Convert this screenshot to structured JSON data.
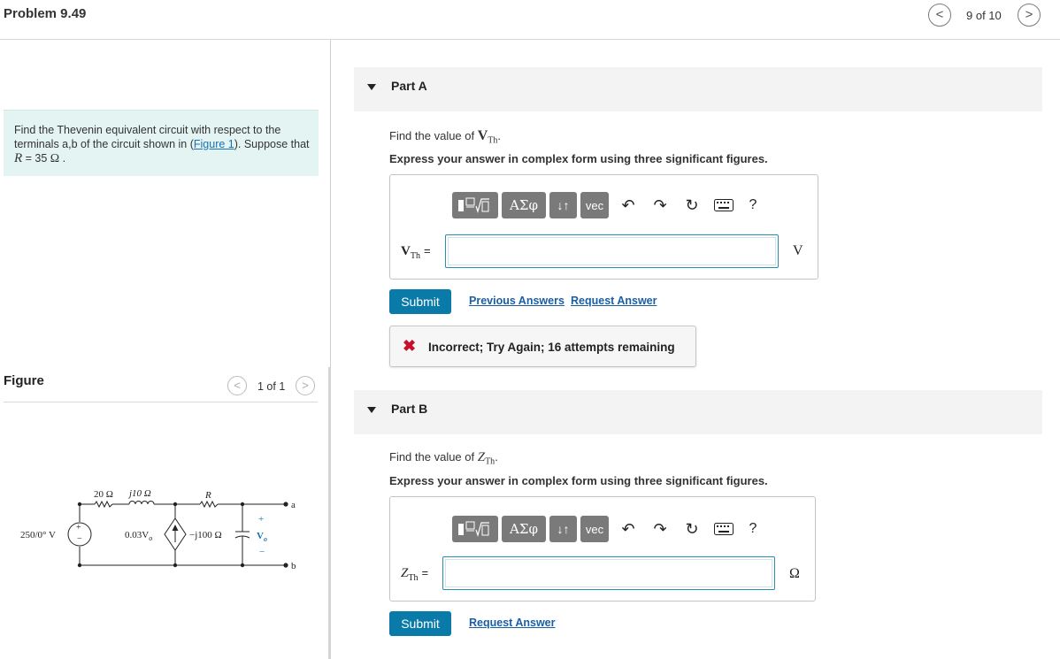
{
  "header": {
    "title": "Problem 9.49",
    "prev_label": "<",
    "next_label": ">",
    "count": "9 of 10"
  },
  "intro": {
    "line1": "Find the Thevenin equivalent circuit with respect to the terminals a,b of the circuit shown in (",
    "link": "Figure 1",
    "line2": "). Suppose that ",
    "var": "R",
    "eq": " = 35 ",
    "unit": "Ω",
    "end": " ."
  },
  "figure": {
    "title": "Figure",
    "count": "1 of 1",
    "prev_label": "<",
    "next_label": ">",
    "labels": {
      "r20": "20 Ω",
      "j10": "j10 Ω",
      "R": "R",
      "a": "a",
      "b": "b",
      "src": "250/0° V",
      "dep": "0.03V",
      "dep_sub": "o",
      "cap": "−j100 Ω",
      "vo": "V",
      "vo_sub": "o",
      "plus": "+",
      "minus": "−"
    }
  },
  "part_a": {
    "label": "Part A",
    "question_prefix": "Find the value of ",
    "var": "V",
    "var_sub": "Th",
    "question_suffix": ".",
    "instruction": "Express your answer in complex form using three significant figures.",
    "answer_label": "V",
    "answer_sub": "Th",
    "answer_eq": "=",
    "unit": "V",
    "submit": "Submit",
    "prev_answers": "Previous Answers",
    "request_answer": "Request Answer",
    "feedback": "Incorrect; Try Again; 16 attempts remaining"
  },
  "part_b": {
    "label": "Part B",
    "question_prefix": "Find the value of ",
    "var": "Z",
    "var_sub": "Th",
    "question_suffix": ".",
    "instruction": "Express your answer in complex form using three significant figures.",
    "answer_label": "Z",
    "answer_sub": "Th",
    "answer_eq": "=",
    "unit": "Ω",
    "submit": "Submit",
    "request_answer": "Request Answer"
  },
  "toolbar": {
    "greek": "ΑΣφ",
    "arrows": "↓↑",
    "vec": "vec",
    "help": "?",
    "icons": [
      "template-icon",
      "undo-icon",
      "redo-icon",
      "reset-icon",
      "keyboard-icon"
    ]
  }
}
